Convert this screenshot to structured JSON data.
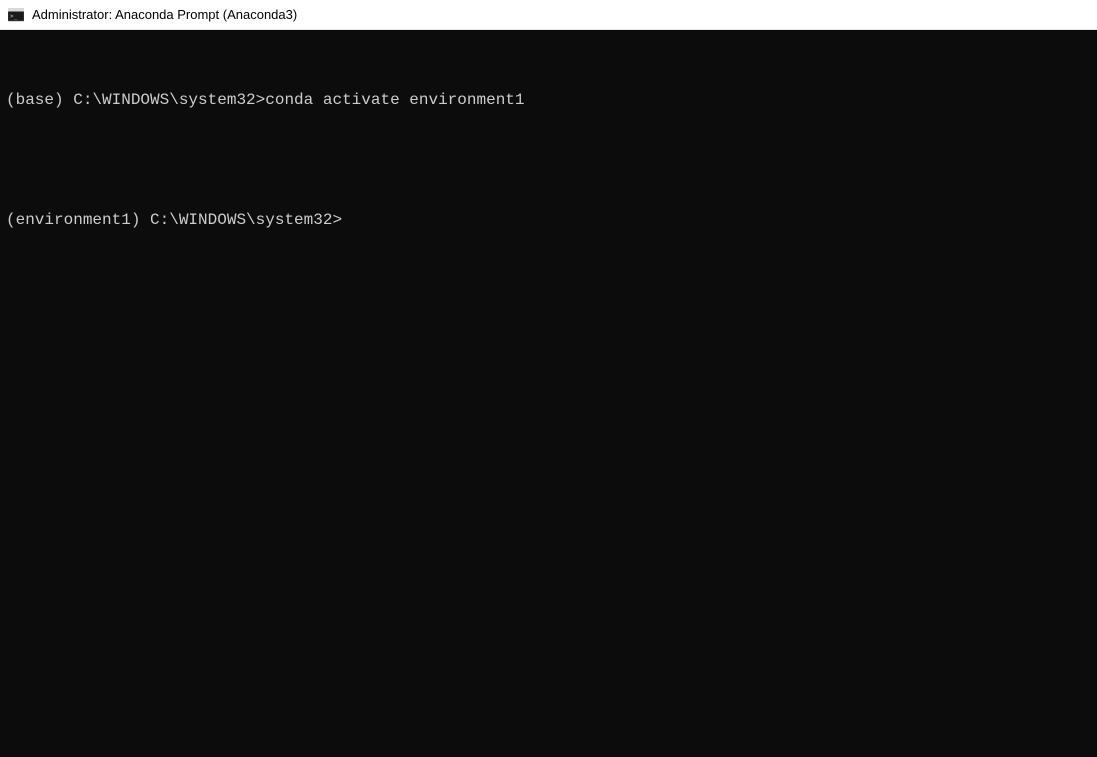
{
  "window": {
    "title": "Administrator: Anaconda Prompt (Anaconda3)",
    "icon_name": "terminal-icon"
  },
  "terminal": {
    "lines": [
      {
        "prompt": "(base) C:\\WINDOWS\\system32>",
        "command": "conda activate environment1"
      },
      {
        "prompt": "",
        "command": ""
      },
      {
        "prompt": "(environment1) C:\\WINDOWS\\system32>",
        "command": ""
      }
    ]
  }
}
